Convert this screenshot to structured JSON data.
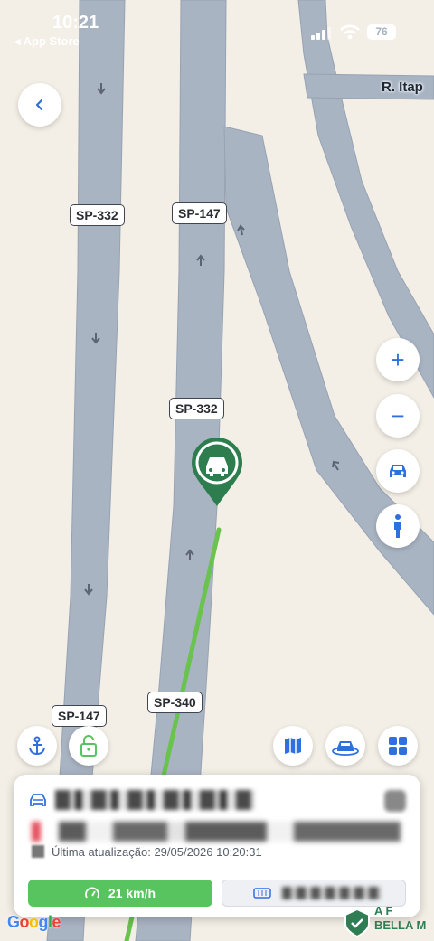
{
  "status_bar": {
    "time": "10:21",
    "back_app": "◂ App Store",
    "battery": "76"
  },
  "map": {
    "road_labels": [
      "SP-332",
      "SP-147",
      "SP-332",
      "SP-340",
      "SP-147"
    ],
    "street_label": "R. Itap",
    "poi_text": [
      "A F",
      "BELLA M"
    ],
    "provider_logo": "Google",
    "colors": {
      "background": "#f3efe6",
      "road": "#a9b4c3",
      "route": "#6ac24f",
      "marker": "#2e7d4f"
    }
  },
  "controls": {
    "back": "chevron-left-icon",
    "zoom_in": "+",
    "zoom_out": "−",
    "car_view": "car-icon",
    "person_view": "person-icon",
    "anchor": "anchor-icon",
    "lock": "lock-icon",
    "map_type": "map-icon",
    "vehicle_3d": "vehicle-icon",
    "grid_menu": "grid-icon"
  },
  "panel": {
    "vehicle_icon": "car-icon",
    "last_update": "Última atualização: 29/05/2026 10:20:31",
    "speed": "21 km/h",
    "accent": "#57c460"
  }
}
